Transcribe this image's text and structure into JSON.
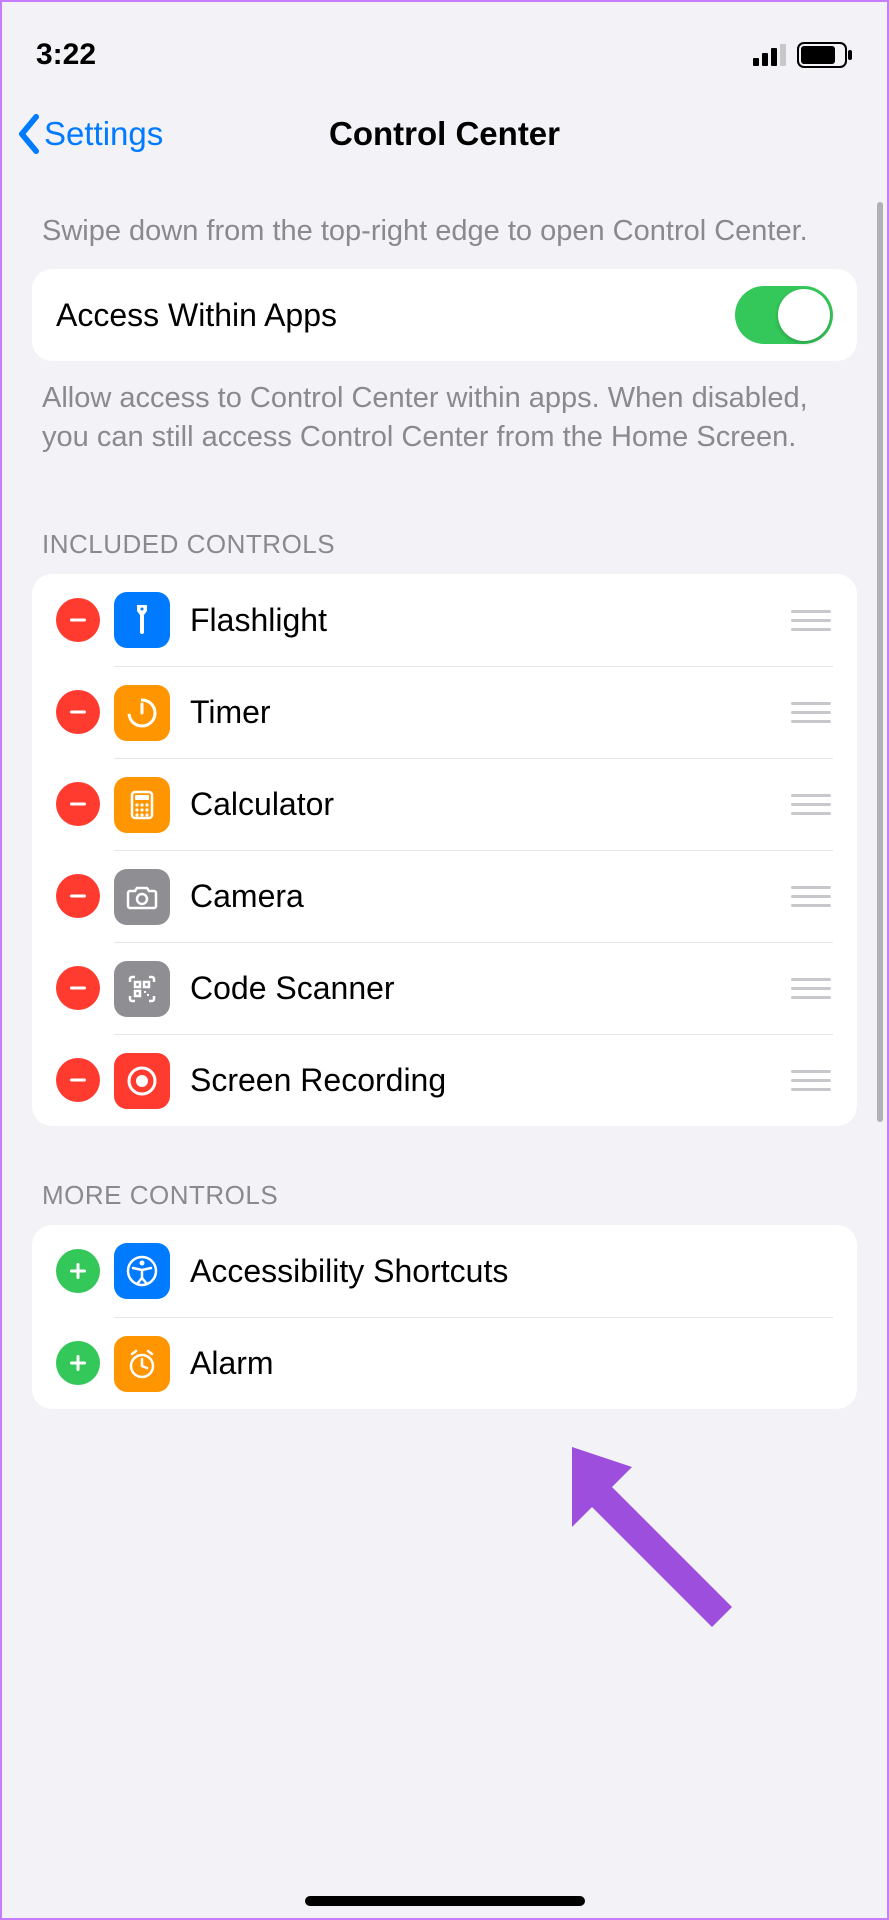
{
  "status": {
    "time": "3:22"
  },
  "nav": {
    "back_label": "Settings",
    "title": "Control Center"
  },
  "help1": "Swipe down from the top-right edge to open Control Center.",
  "access": {
    "label": "Access Within Apps",
    "on": true
  },
  "help2": "Allow access to Control Center within apps. When disabled, you can still access Control Center from the Home Screen.",
  "sections": {
    "included": {
      "header": "INCLUDED CONTROLS",
      "items": [
        {
          "label": "Flashlight",
          "icon": "flashlight",
          "color": "ic-blue"
        },
        {
          "label": "Timer",
          "icon": "timer",
          "color": "ic-orange"
        },
        {
          "label": "Calculator",
          "icon": "calculator",
          "color": "ic-orange"
        },
        {
          "label": "Camera",
          "icon": "camera",
          "color": "ic-gray"
        },
        {
          "label": "Code Scanner",
          "icon": "qr",
          "color": "ic-gray"
        },
        {
          "label": "Screen Recording",
          "icon": "record",
          "color": "ic-red"
        }
      ]
    },
    "more": {
      "header": "MORE CONTROLS",
      "items": [
        {
          "label": "Accessibility Shortcuts",
          "icon": "accessibility",
          "color": "ic-blue"
        },
        {
          "label": "Alarm",
          "icon": "alarm",
          "color": "ic-orange"
        }
      ]
    }
  }
}
